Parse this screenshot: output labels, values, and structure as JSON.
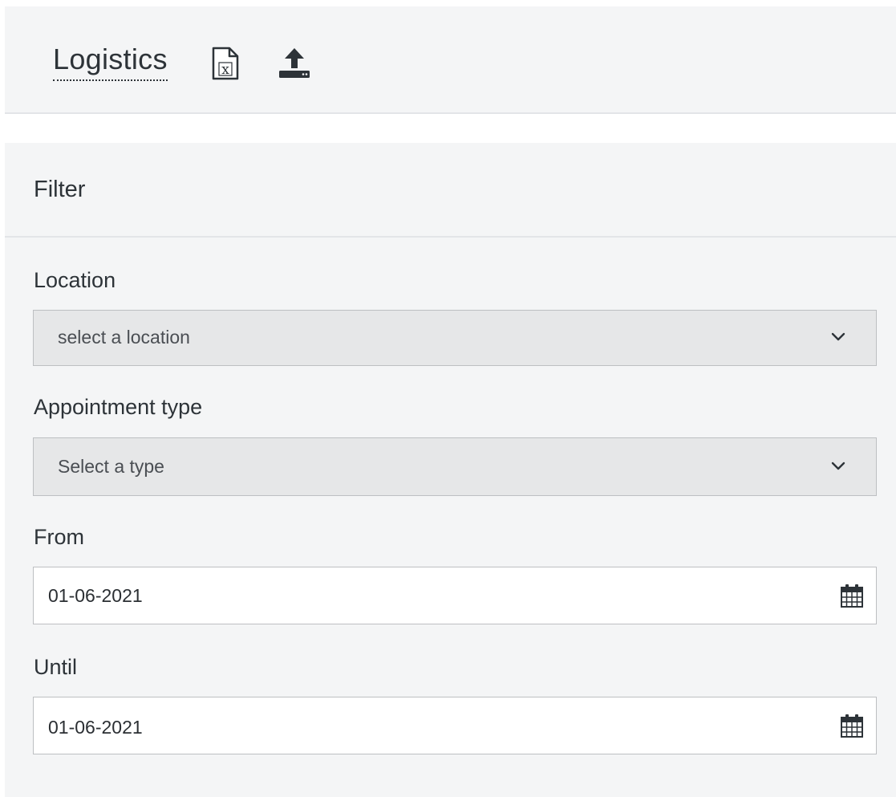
{
  "header": {
    "title": "Logistics",
    "icons": [
      "excel-file-icon",
      "upload-icon"
    ]
  },
  "filter": {
    "heading": "Filter",
    "location": {
      "label": "Location",
      "placeholder": "select a location"
    },
    "appointment_type": {
      "label": "Appointment type",
      "placeholder": "Select a type"
    },
    "from": {
      "label": "From",
      "value": "01-06-2021"
    },
    "until": {
      "label": "Until",
      "value": "01-06-2021"
    }
  },
  "colors": {
    "panel_background": "#f4f5f6",
    "select_background": "#e6e7e8",
    "text": "#2d3338",
    "border": "#bdbfc2"
  }
}
